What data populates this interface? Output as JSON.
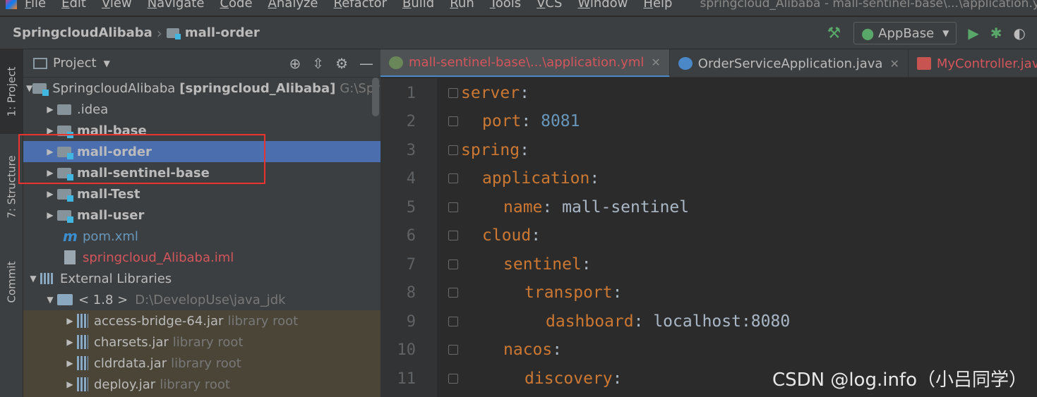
{
  "menu": [
    "File",
    "Edit",
    "View",
    "Navigate",
    "Code",
    "Analyze",
    "Refactor",
    "Build",
    "Run",
    "Tools",
    "VCS",
    "Window",
    "Help"
  ],
  "window_title": "springcloud_Alibaba - mall-sentinel-base\\...\\application.yml",
  "breadcrumb": {
    "project": "SpringcloudAlibaba",
    "module": "mall-order"
  },
  "run_config": "AppBase",
  "toolstrip": {
    "project": "1: Project",
    "structure": "7: Structure",
    "commit": "Commit"
  },
  "project_panel": {
    "title": "Project",
    "tree": [
      {
        "name": "SpringcloudAlibaba",
        "extra": "[springcloud_Alibaba]",
        "hint": "G:\\Spri"
      },
      {
        "name": ".idea"
      },
      {
        "name": "mall-base"
      },
      {
        "name": "mall-order"
      },
      {
        "name": "mall-sentinel-base"
      },
      {
        "name": "mall-Test"
      },
      {
        "name": "mall-user"
      },
      {
        "name": "pom.xml"
      },
      {
        "name": "springcloud_Alibaba.iml"
      },
      {
        "name": "External Libraries"
      },
      {
        "name": "< 1.8 >",
        "hint": "D:\\DevelopUse\\java_jdk"
      },
      {
        "name": "access-bridge-64.jar",
        "hint": "library root"
      },
      {
        "name": "charsets.jar",
        "hint": "library root"
      },
      {
        "name": "cldrdata.jar",
        "hint": "library root"
      },
      {
        "name": "deploy.jar",
        "hint": "library root"
      }
    ]
  },
  "tabs": [
    {
      "label": "mall-sentinel-base\\...\\application.yml"
    },
    {
      "label": "OrderServiceApplication.java"
    },
    {
      "label": "MyController.java"
    }
  ],
  "code_lines": [
    {
      "num": "1",
      "key": "server",
      "sep": ":",
      "val": ""
    },
    {
      "num": "2",
      "key": "port",
      "sep": ": ",
      "val": "8081"
    },
    {
      "num": "3",
      "key": "spring",
      "sep": ":",
      "val": ""
    },
    {
      "num": "4",
      "key": "application",
      "sep": ":",
      "val": ""
    },
    {
      "num": "5",
      "key": "name",
      "sep": ": ",
      "val": "mall-sentinel"
    },
    {
      "num": "6",
      "key": "cloud",
      "sep": ":",
      "val": ""
    },
    {
      "num": "7",
      "key": "sentinel",
      "sep": ":",
      "val": ""
    },
    {
      "num": "8",
      "key": "transport",
      "sep": ":",
      "val": ""
    },
    {
      "num": "9",
      "key": "dashboard",
      "sep": ": ",
      "val": "localhost:8080"
    },
    {
      "num": "10",
      "key": "nacos",
      "sep": ":",
      "val": ""
    },
    {
      "num": "11",
      "key": "discovery",
      "sep": ":",
      "val": ""
    }
  ],
  "watermark": "CSDN @log.info（小吕同学）",
  "colors": {
    "selection": "#4b6eaf",
    "annotation": "#e8332f",
    "yaml_key": "#cc7832",
    "number": "#6897bb"
  }
}
